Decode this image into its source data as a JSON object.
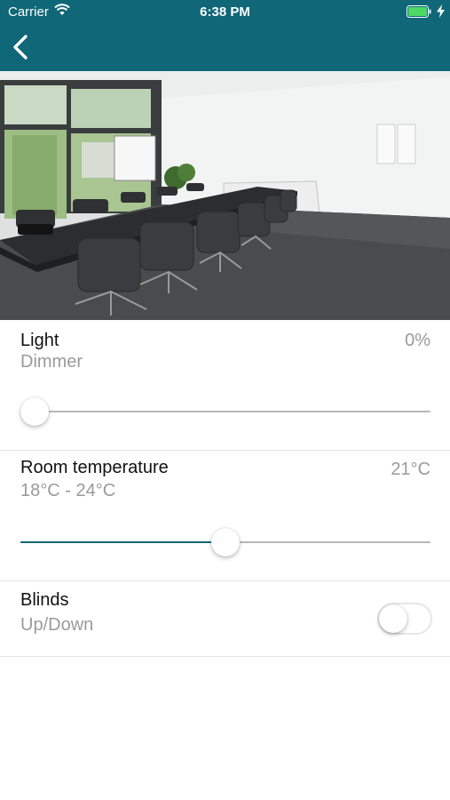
{
  "status_bar": {
    "carrier": "Carrier",
    "time": "6:38 PM",
    "wifi_icon": "wifi-icon",
    "battery_icon": "battery-icon",
    "charging_icon": "bolt-icon"
  },
  "nav": {
    "back_icon": "chevron-left-icon",
    "bar_color": "#0f6777"
  },
  "room_image": "conference-room-photo",
  "controls": {
    "light": {
      "title": "Light",
      "subtitle": "Dimmer",
      "value": "0%",
      "level_fraction": 0.0
    },
    "temperature": {
      "title": "Room temperature",
      "subtitle": "18°C - 24°C",
      "value": "21°C",
      "level_fraction": 0.5
    },
    "blinds": {
      "title": "Blinds",
      "subtitle": "Up/Down",
      "on": false
    }
  },
  "colors": {
    "accent": "#0f6777",
    "secondary_text": "#9a9a9a",
    "track": "#b8b8b8"
  }
}
